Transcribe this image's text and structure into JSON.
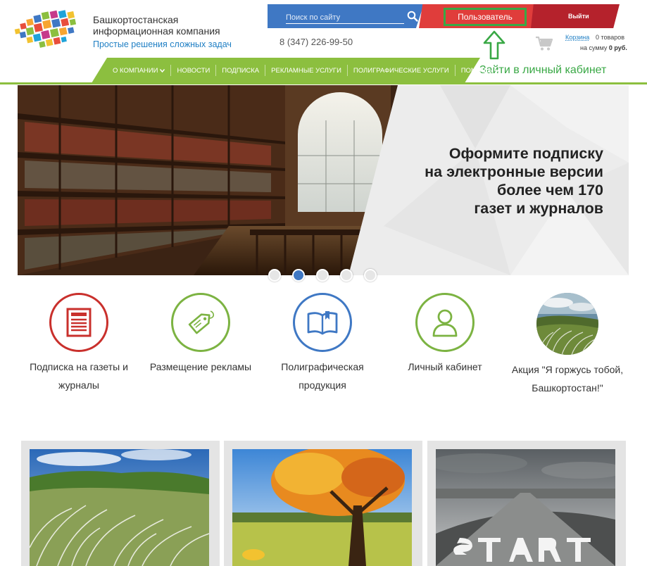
{
  "brand": {
    "line1": "Башкортостанская",
    "line2": "информационная компания",
    "tagline": "Простые решения сложных задач"
  },
  "header": {
    "search_placeholder": "Поиск по сайту",
    "phone": "8 (347) 226-99-50",
    "user_label": "Пользователь",
    "logout_label": "Выйти",
    "cart_link": "Корзина",
    "cart_count": "0 товаров",
    "cart_sum_prefix": "на сумму",
    "cart_sum_value": "0 руб."
  },
  "annotation": {
    "hint": "Зайти в личный кабинет"
  },
  "nav": {
    "items": [
      {
        "label": "О КОМПАНИИ",
        "dropdown": true
      },
      {
        "label": "НОВОСТИ",
        "dropdown": false
      },
      {
        "label": "ПОДПИСКА",
        "dropdown": false
      },
      {
        "label": "РЕКЛАМНЫЕ УСЛУГИ",
        "dropdown": false
      },
      {
        "label": "ПОЛИГРАФИЧЕСКИЕ УСЛУГИ",
        "dropdown": false
      },
      {
        "label": "ПОМОЩЬ",
        "dropdown": true
      }
    ]
  },
  "hero": {
    "line1": "Оформите подписку",
    "line2": "на электронные версии",
    "line3": "более чем 170",
    "line4": "газет и журналов",
    "active_slide": 2,
    "slide_count": 5
  },
  "services": [
    {
      "label1": "Подписка на газеты и",
      "label2": "журналы",
      "icon": "newspaper-icon",
      "color": "#c9302c"
    },
    {
      "label1": "Размещение рекламы",
      "label2": "",
      "icon": "tag-icon",
      "color": "#7cb342"
    },
    {
      "label1": "Полиграфическая",
      "label2": "продукция",
      "icon": "book-icon",
      "color": "#3f78c4"
    },
    {
      "label1": "Личный кабинет",
      "label2": "",
      "icon": "user-icon",
      "color": "#7cb342"
    },
    {
      "label1": "Акция \"Я горжусь тобой,",
      "label2": "Башкортостан!\"",
      "icon": "feather-grass-photo",
      "color": "#7cb342"
    }
  ],
  "colors": {
    "green": "#8cbf3f",
    "blue": "#3f78c4",
    "red": "#e03d3b",
    "dark_red": "#b5222c",
    "highlight": "#39a845"
  }
}
